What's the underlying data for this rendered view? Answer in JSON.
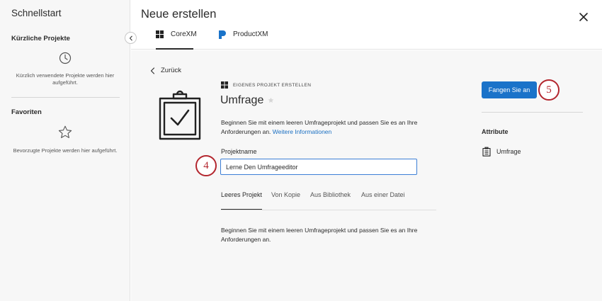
{
  "sidebar": {
    "title": "Schnellstart",
    "recent_heading": "Kürzliche Projekte",
    "recent_empty": "Kürzlich verwendete Projekte werden hier aufgeführt.",
    "favorites_heading": "Favoriten",
    "favorites_empty": "Bevorzugte Projekte werden hier aufgeführt."
  },
  "header": {
    "title": "Neue erstellen",
    "tabs": [
      {
        "label": "CoreXM",
        "active": true
      },
      {
        "label": "ProductXM",
        "active": false
      }
    ]
  },
  "main": {
    "back_label": "Zurück",
    "eyebrow": "EIGENES PROJEKT ERSTELLEN",
    "project_type": "Umfrage",
    "description": "Beginnen Sie mit einem leeren Umfrageprojekt und passen Sie es an Ihre Anforderungen an.",
    "more_info": "Weitere Informationen",
    "name_label": "Projektname",
    "name_value": "Lerne Den Umfrageeditor",
    "subtabs": [
      {
        "label": "Leeres Projekt",
        "active": true
      },
      {
        "label": "Von Kopie",
        "active": false
      },
      {
        "label": "Aus Bibliothek",
        "active": false
      },
      {
        "label": "Aus einer Datei",
        "active": false
      }
    ],
    "subtab_description": "Beginnen Sie mit einem leeren Umfrageprojekt und passen Sie es an Ihre Anforderungen an."
  },
  "right_panel": {
    "start_button": "Fangen Sie an",
    "attributes_heading": "Attribute",
    "attribute_item": "Umfrage"
  },
  "callouts": {
    "step4": "4",
    "step5": "5"
  },
  "colors": {
    "accent": "#1a73c9",
    "callout": "#b3262e",
    "productxm": "#1a73c9"
  },
  "icons": {
    "recent": "clock-icon",
    "favorites": "star-outline-icon",
    "corexm": "corexm-logo-icon",
    "productxm": "productxm-logo-icon",
    "clipboard": "clipboard-check-icon",
    "attribute": "clipboard-small-icon"
  }
}
